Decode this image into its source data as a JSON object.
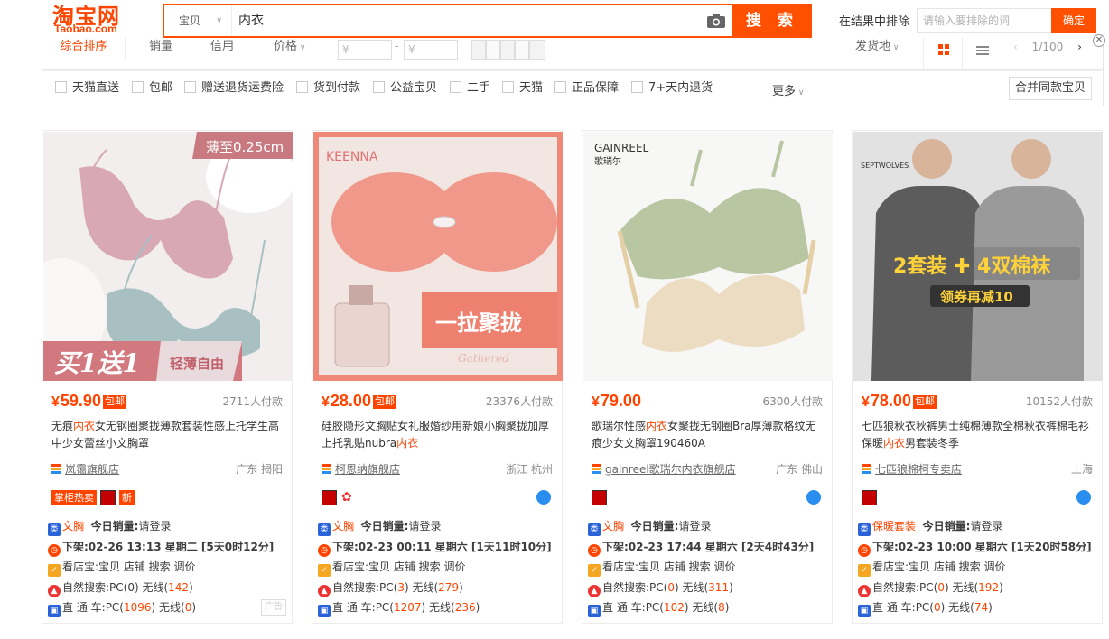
{
  "header": {
    "logo_cn": "淘宝网",
    "logo_en": "Taobao.com",
    "search_category": "宝贝",
    "search_query": "内衣",
    "search_button": "搜 索",
    "exclude_label": "在结果中排除",
    "exclude_placeholder": "请输入要排除的词",
    "exclude_button": "确定"
  },
  "sort": {
    "items": [
      "综合排序",
      "销量",
      "信用",
      "价格"
    ],
    "price_min_placeholder": "¥",
    "price_max_placeholder": "¥",
    "ship_from": "发货地",
    "page_indicator": "1/100"
  },
  "filters": {
    "items": [
      "天猫直送",
      "包邮",
      "赠送退货运费险",
      "货到付款",
      "公益宝贝",
      "二手",
      "天猫",
      "正品保障",
      "7+天内退货"
    ],
    "more": "更多",
    "merge": "合并同款宝贝"
  },
  "products": [
    {
      "image_text_top": "薄至0.25cm",
      "image_text_big": "买1送1",
      "image_text_small": "轻薄自由",
      "price": "59.90",
      "free_ship": "包邮",
      "sales": "2711人付款",
      "title_pre": "无痕",
      "title_hl": "内衣",
      "title_post": "女无钢圈聚拢薄款套装性感上托学生高中少女蕾丝小文胸罩",
      "shop": "岚霭旗舰店",
      "location": "广东 揭阳",
      "tag1": "掌柜热卖",
      "tag2": "新",
      "category": "文胸",
      "today_label": "今日销量:",
      "today_value": "请登录",
      "offshelf": "下架:02-26 13:13 星期二 [5天0时12分]",
      "store_line": "看店宝:宝贝 店铺 搜索 调价",
      "natural_pc": "142",
      "natural_pc_label": "自然搜索:PC(0) 无线(",
      "ztc_pc": "1096",
      "ztc_wx": "0",
      "ad": "广告"
    },
    {
      "image_text_top": "KEENNA",
      "image_text_big": "一拉聚拢",
      "image_text_small": "Gathered",
      "price": "28.00",
      "free_ship": "包邮",
      "sales": "23376人付款",
      "title_pre": "硅胶隐形文胸贴女礼服婚纱用新娘小胸聚拢加厚上托乳贴nubra",
      "title_hl": "内衣",
      "title_post": "",
      "shop": "柯恩纳旗舰店",
      "location": "浙江 杭州",
      "category": "文胸",
      "today_label": "今日销量:",
      "today_value": "请登录",
      "offshelf": "下架:02-23 00:11 星期六 [1天11时10分]",
      "store_line": "看店宝:宝贝 店铺 搜索 调价",
      "natural_pc": "3",
      "natural_wx": "279",
      "ztc_pc": "1207",
      "ztc_wx": "236"
    },
    {
      "image_text_top": "GAINREEL",
      "image_text_sub": "歌瑞尔",
      "price": "79.00",
      "sales": "6300人付款",
      "title_pre": "歌瑞尔性感",
      "title_hl": "内衣",
      "title_post": "女聚拢无钢圈Bra厚薄款格纹无痕少女文胸罩190460A",
      "shop": "gainreel歌瑞尔内衣旗舰店",
      "location": "广东 佛山",
      "category": "文胸",
      "today_label": "今日销量:",
      "today_value": "请登录",
      "offshelf": "下架:02-23 17:44 星期六 [2天4时43分]",
      "store_line": "看店宝:宝贝 店铺 搜索 调价",
      "natural_pc": "0",
      "natural_wx": "311",
      "ztc_pc": "102",
      "ztc_wx": "8"
    },
    {
      "image_text_top": "SEPTWOLVES",
      "image_text_big": "2套装 ✚ 4双棉袜",
      "image_text_small": "领券再减10",
      "price": "78.00",
      "free_ship": "包邮",
      "sales": "10152人付款",
      "title_pre": "七匹狼秋衣秋裤男士纯棉薄款全棉秋衣裤棉毛衫保暖",
      "title_hl": "内衣",
      "title_post": "男套装冬季",
      "shop": "七匹狼棉柯专卖店",
      "location": "上海",
      "category": "保暖套装",
      "today_label": "今日销量:",
      "today_value": "请登录",
      "offshelf": "下架:02-23 10:00 星期六 [1天20时58分]",
      "store_line": "看店宝:宝贝 店铺 搜索 调价",
      "natural_pc": "0",
      "natural_wx": "192",
      "ztc_pc": "0",
      "ztc_wx": "74"
    }
  ],
  "labels": {
    "natural": "自然搜索:",
    "ztc": "直 通 车:",
    "yen": "¥"
  }
}
